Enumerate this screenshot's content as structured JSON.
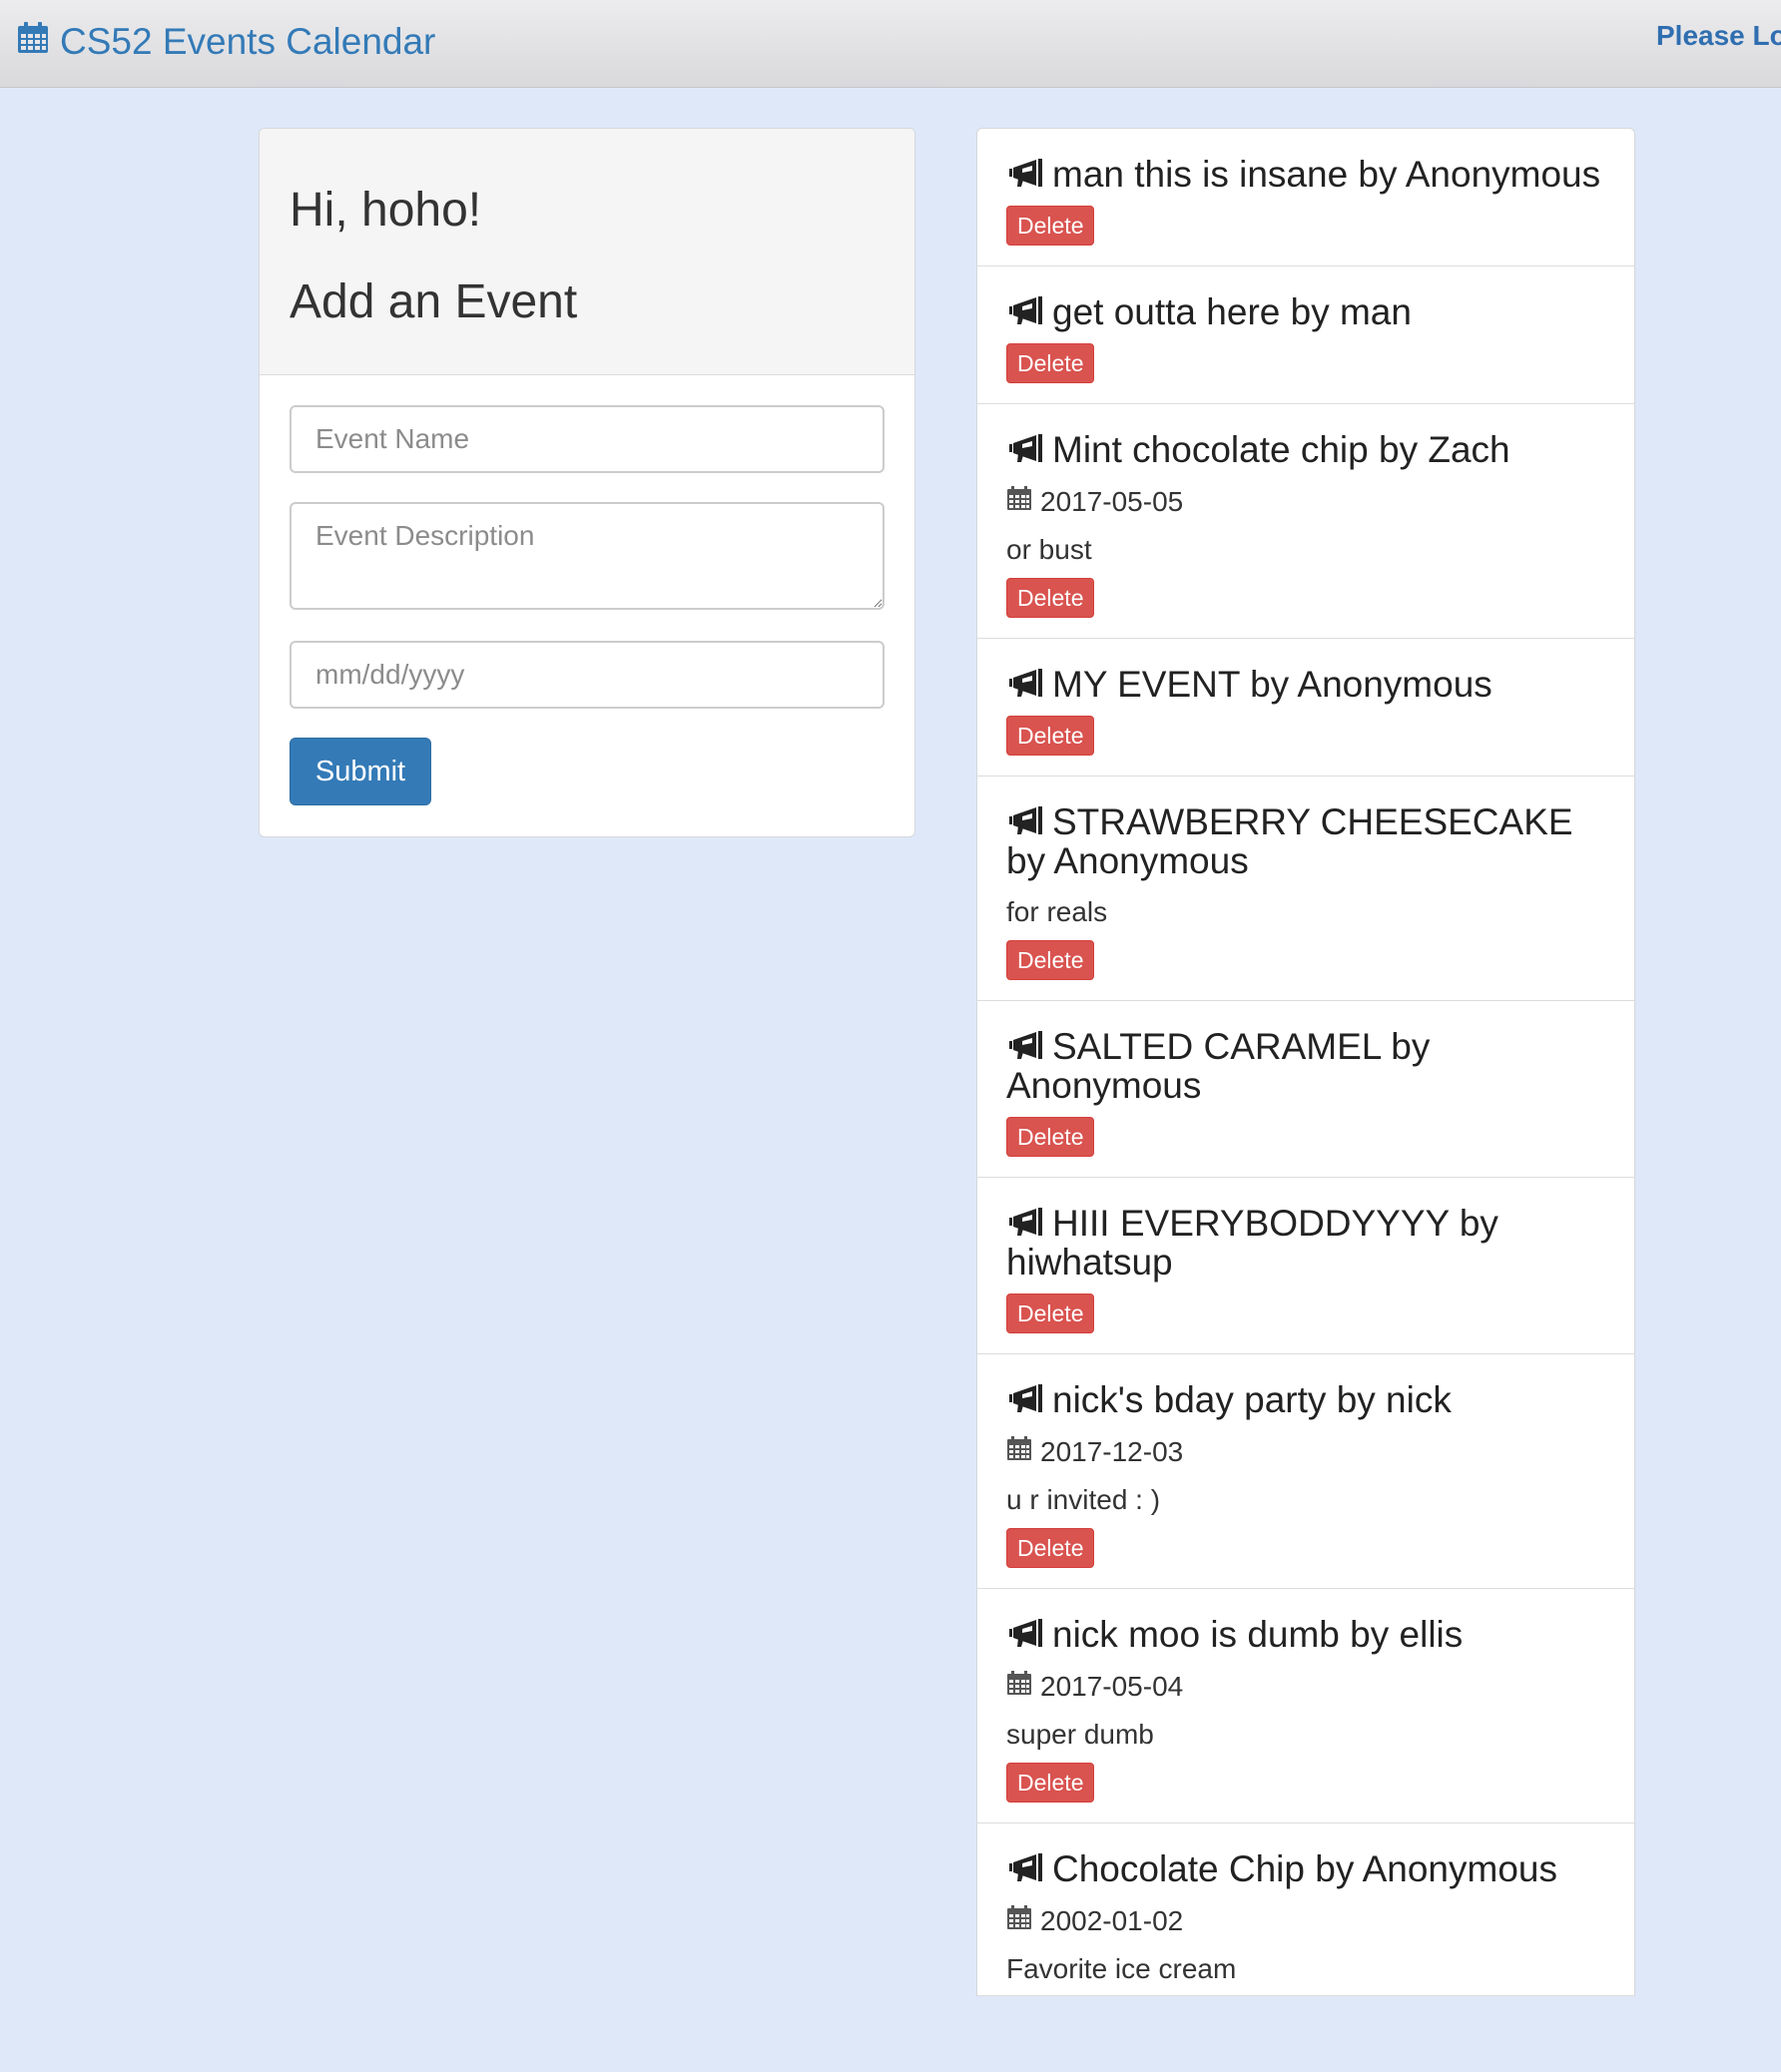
{
  "navbar": {
    "brand": "CS52 Events Calendar",
    "brand_icon": "calendar-icon",
    "login": "Please Lo"
  },
  "form": {
    "greeting": "Hi, hoho!",
    "title": "Add an Event",
    "name_placeholder": "Event Name",
    "description_placeholder": "Event Description",
    "date_placeholder": "mm/dd/yyyy",
    "submit_label": "Submit"
  },
  "delete_label": "Delete",
  "colors": {
    "page_bg": "#dfe8f8",
    "primary": "#337ab7",
    "danger": "#d9534f"
  },
  "events": [
    {
      "title": "man this is insane by Anonymous",
      "date": "",
      "description": ""
    },
    {
      "title": "get outta here by man",
      "date": "",
      "description": ""
    },
    {
      "title": "Mint chocolate chip by Zach",
      "date": "2017-05-05",
      "description": "or bust"
    },
    {
      "title": "MY EVENT by Anonymous",
      "date": "",
      "description": ""
    },
    {
      "title": "STRAWBERRY CHEESECAKE by Anonymous",
      "date": "",
      "description": "for reals"
    },
    {
      "title": "SALTED CARAMEL by Anonymous",
      "date": "",
      "description": ""
    },
    {
      "title": "HIII EVERYBODDYYYY by hiwhatsup",
      "date": "",
      "description": ""
    },
    {
      "title": "nick's bday party by nick",
      "date": "2017-12-03",
      "description": "u r invited : )"
    },
    {
      "title": "nick moo is dumb by ellis",
      "date": "2017-05-04",
      "description": "super dumb"
    },
    {
      "title": "Chocolate Chip by Anonymous",
      "date": "2002-01-02",
      "description": "Favorite ice cream"
    }
  ]
}
